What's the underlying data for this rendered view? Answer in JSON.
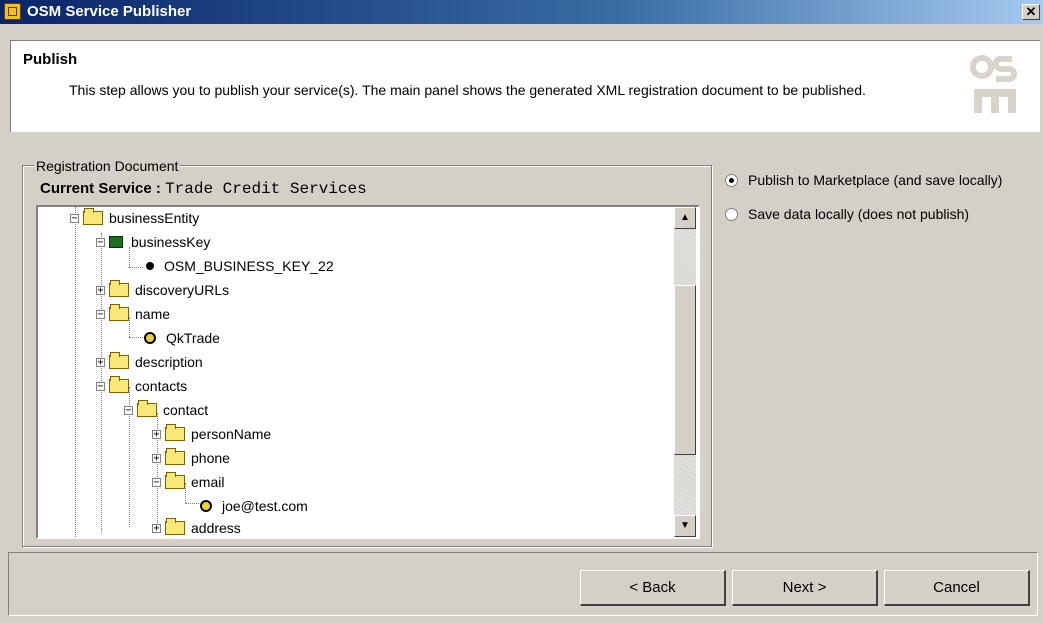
{
  "window": {
    "title": "OSM Service Publisher",
    "close_glyph": "✕"
  },
  "header": {
    "title": "Publish",
    "description": "This step allows you to publish your service(s). The main panel shows the generated XML registration document to be published.",
    "logo_text": "OSM"
  },
  "registration": {
    "group_label": "Registration Document",
    "current_service_label": "Current Service :",
    "current_service_value": "Trade Credit Services"
  },
  "tree": {
    "nodes": [
      {
        "label": "businessEntity",
        "icon": "folder-icon",
        "expander": "minus"
      },
      {
        "label": "businessKey",
        "icon": "key-icon",
        "expander": "minus"
      },
      {
        "label": "OSM_BUSINESS_KEY_22",
        "icon": "bullet-icon",
        "expander": "none"
      },
      {
        "label": "discoveryURLs",
        "icon": "folder-icon",
        "expander": "plus"
      },
      {
        "label": "name",
        "icon": "folder-icon",
        "expander": "minus"
      },
      {
        "label": "QkTrade",
        "icon": "value-ring-icon",
        "expander": "none"
      },
      {
        "label": "description",
        "icon": "folder-icon",
        "expander": "plus"
      },
      {
        "label": "contacts",
        "icon": "folder-icon",
        "expander": "minus"
      },
      {
        "label": "contact",
        "icon": "folder-icon",
        "expander": "minus"
      },
      {
        "label": "personName",
        "icon": "folder-icon",
        "expander": "plus"
      },
      {
        "label": "phone",
        "icon": "folder-icon",
        "expander": "plus"
      },
      {
        "label": "email",
        "icon": "folder-icon",
        "expander": "minus"
      },
      {
        "label": "joe@test.com",
        "icon": "value-ring-icon",
        "expander": "none"
      },
      {
        "label": "address",
        "icon": "folder-icon",
        "expander": "plus"
      }
    ]
  },
  "options": {
    "publish_label": "Publish to Marketplace (and save locally)",
    "save_label": "Save data locally (does not publish)",
    "selected": "publish"
  },
  "buttons": {
    "back": "< Back",
    "next": "Next >",
    "cancel": "Cancel"
  }
}
